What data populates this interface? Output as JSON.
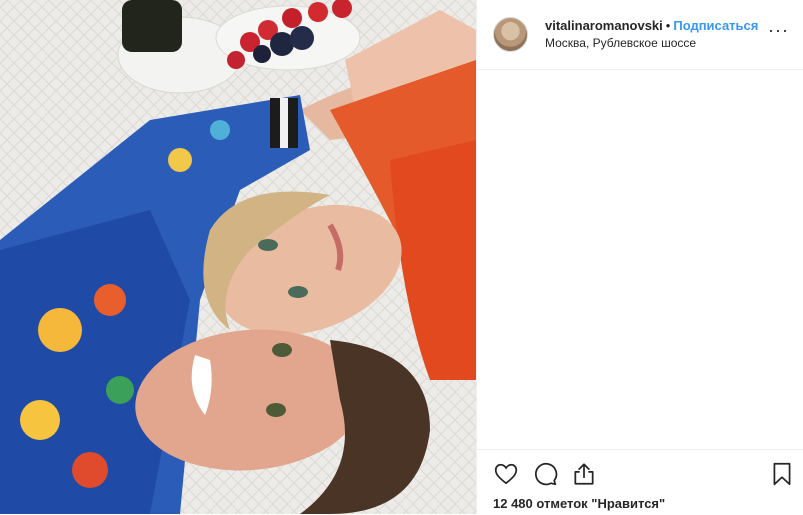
{
  "header": {
    "username": "vitalinaromanovski",
    "separator": "•",
    "follow_label": "Подписаться",
    "location": "Москва, Рублевское шоссе",
    "more_label": "···"
  },
  "actions": {
    "icons": [
      "heart-icon",
      "comment-icon",
      "share-icon",
      "bookmark-icon"
    ]
  },
  "likes": {
    "text": "12 480 отметок \"Нравится\""
  },
  "colors": {
    "accent": "#3897f0",
    "text": "#262626",
    "border": "#efefef"
  }
}
